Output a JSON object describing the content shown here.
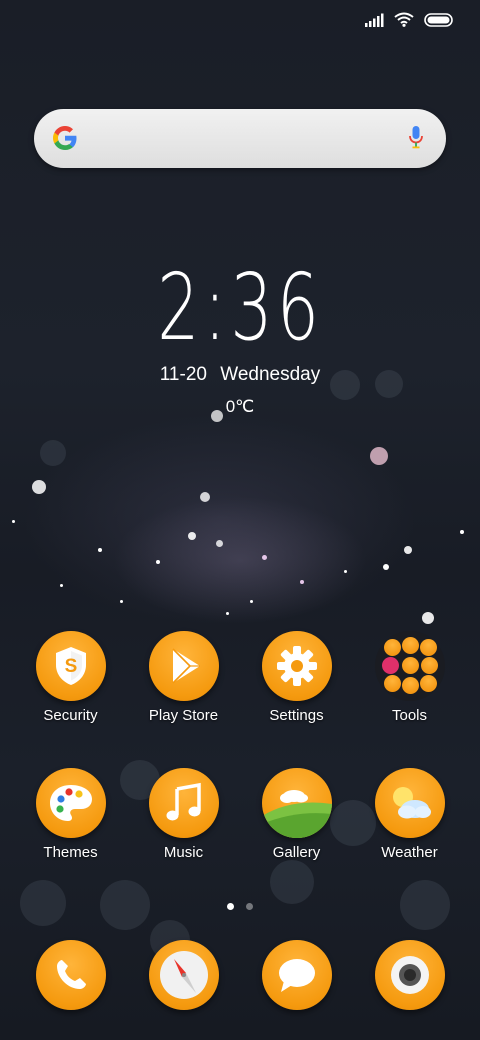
{
  "status_bar": {
    "icons": [
      "signal-icon",
      "wifi-icon",
      "battery-icon"
    ]
  },
  "search_bar": {
    "logo": "google-logo",
    "mic": "microphone-icon"
  },
  "clock": {
    "time": "2:36",
    "date": "11-20",
    "weekday": "Wednesday",
    "temperature": "0℃"
  },
  "apps_row1": [
    {
      "label": "Security",
      "icon": "shield-icon"
    },
    {
      "label": "Play Store",
      "icon": "play-store-icon"
    },
    {
      "label": "Settings",
      "icon": "gear-icon"
    },
    {
      "label": "Tools",
      "icon": "folder-icon"
    }
  ],
  "apps_row2": [
    {
      "label": "Themes",
      "icon": "palette-icon"
    },
    {
      "label": "Music",
      "icon": "music-note-icon"
    },
    {
      "label": "Gallery",
      "icon": "gallery-icon"
    },
    {
      "label": "Weather",
      "icon": "weather-icon"
    }
  ],
  "dock": [
    {
      "icon": "phone-icon"
    },
    {
      "icon": "compass-icon"
    },
    {
      "icon": "message-icon"
    },
    {
      "icon": "camera-icon"
    }
  ],
  "page_indicator": {
    "pages": 2,
    "current": 1
  },
  "colors": {
    "accent": "#f59a0f",
    "label": "#ffffff"
  }
}
